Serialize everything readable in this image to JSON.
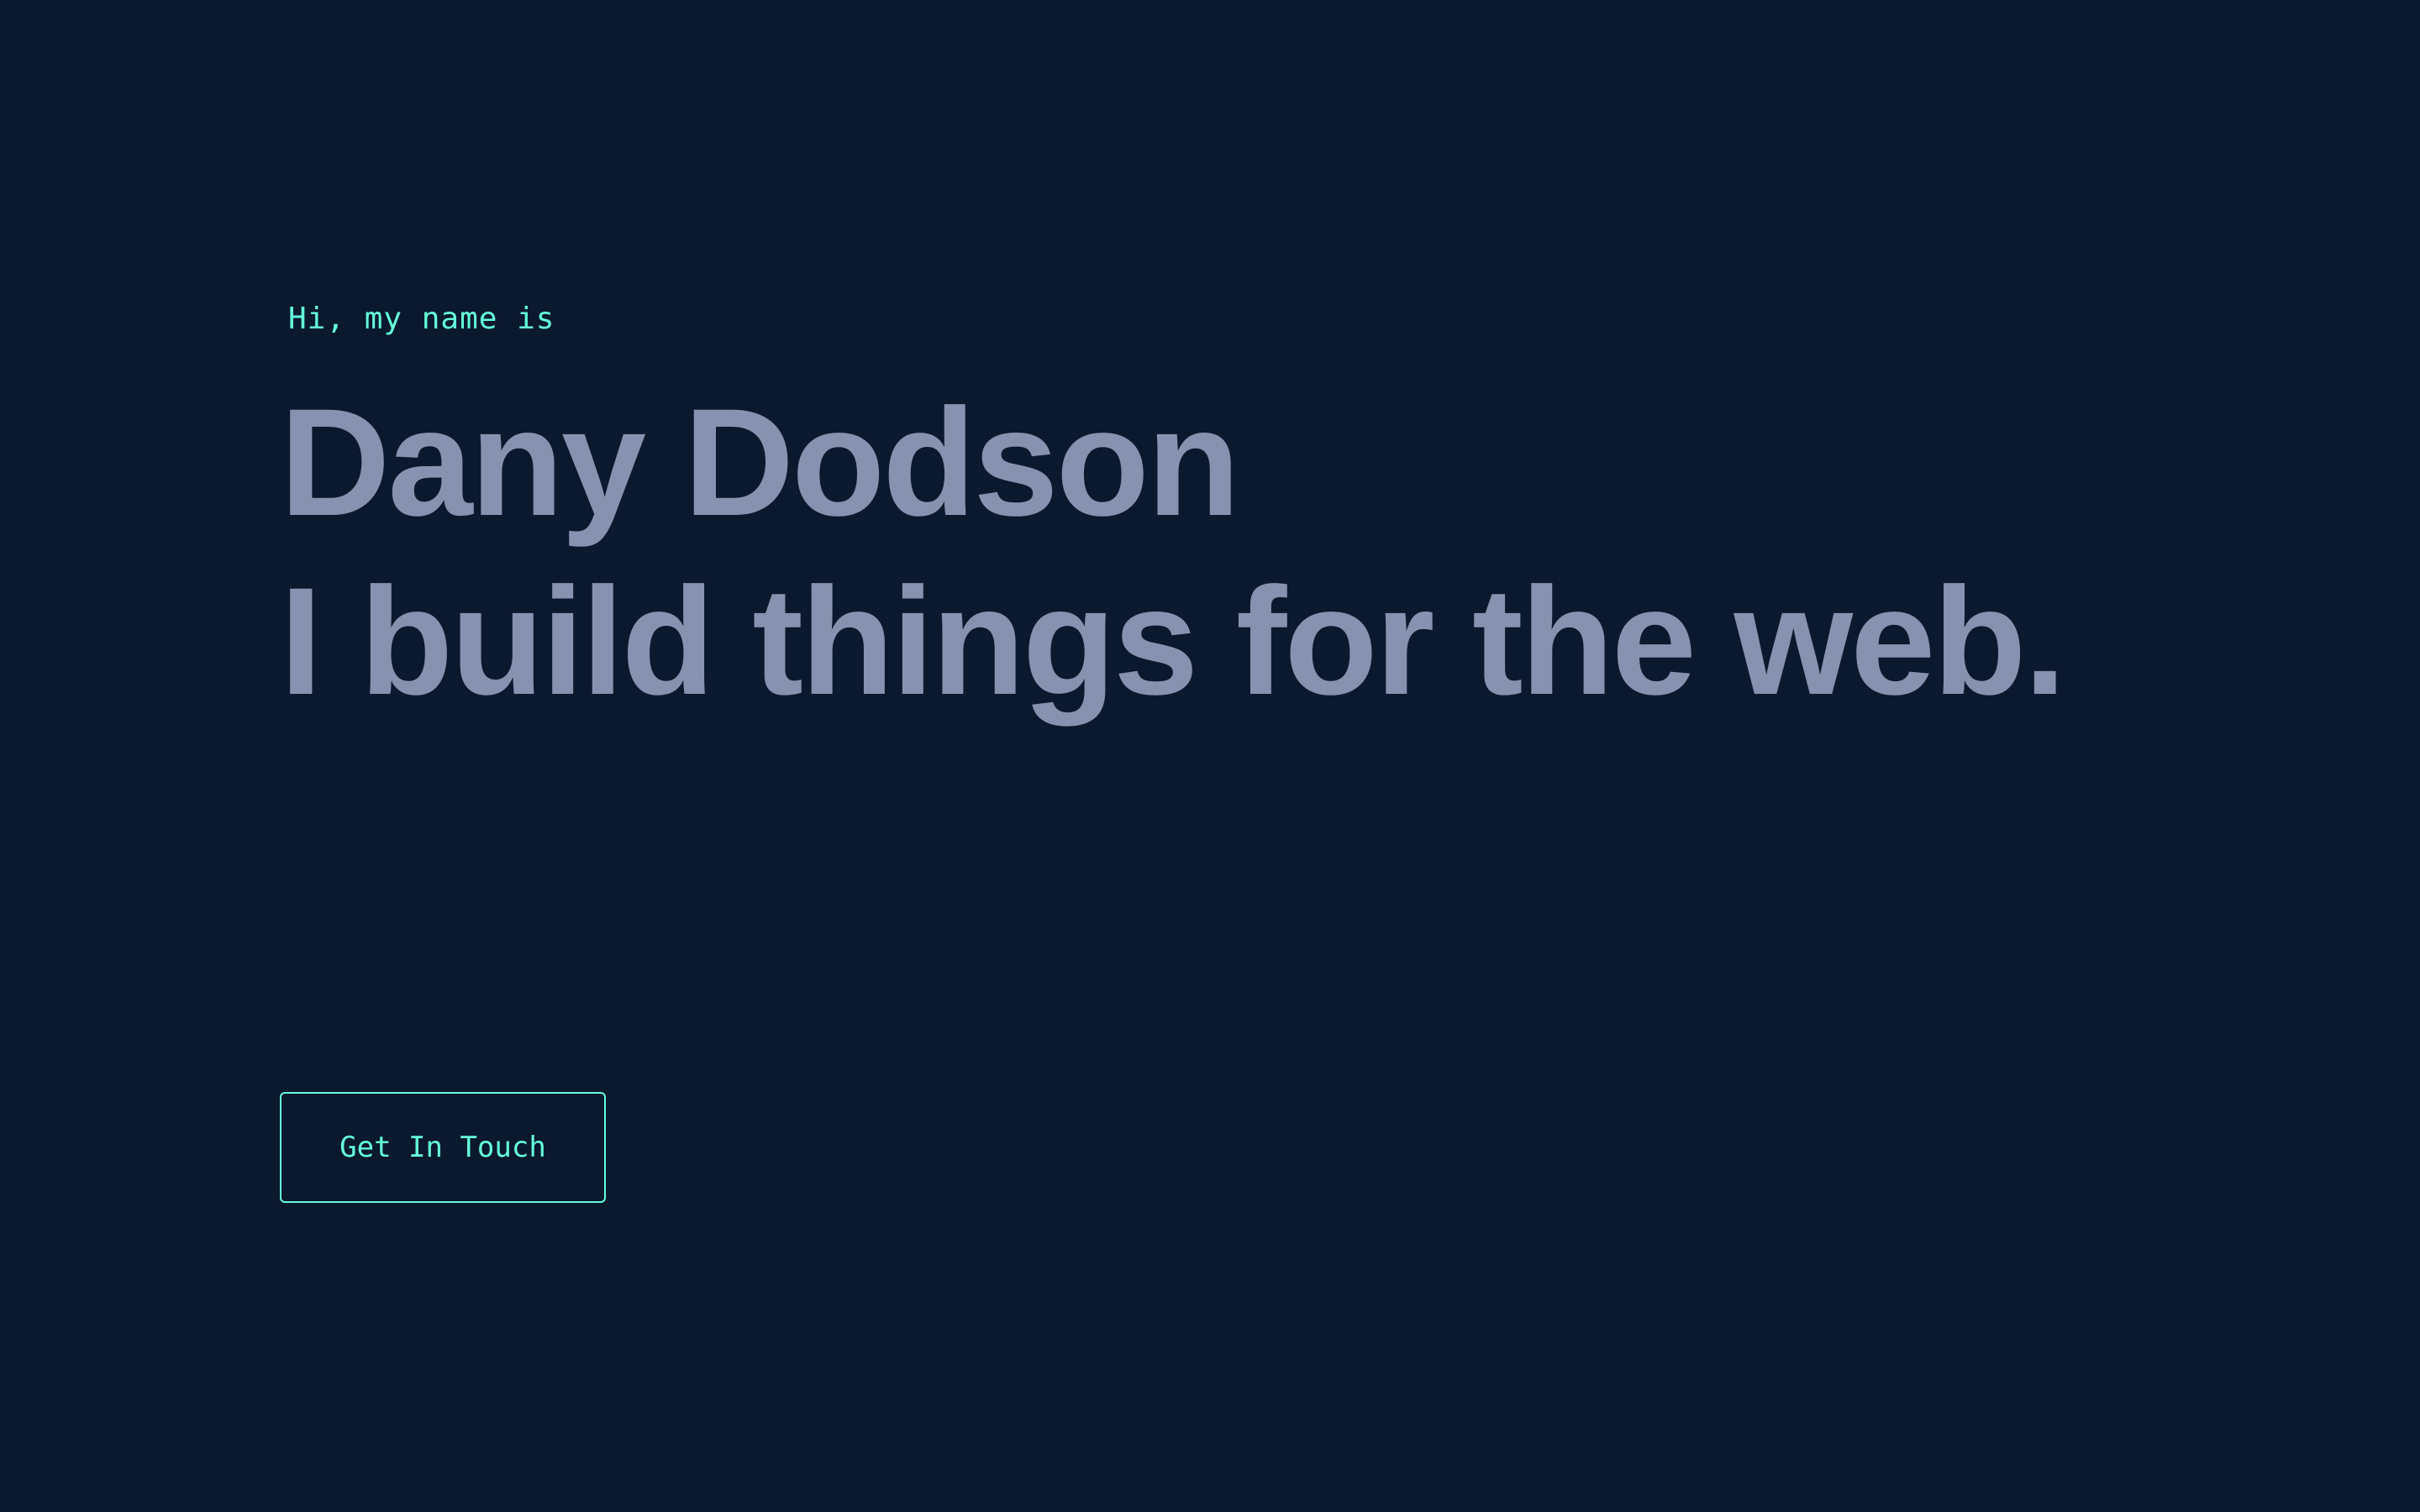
{
  "hero": {
    "greeting": "Hi, my name is",
    "name": "Dany Dodson",
    "tagline": "I build things for the web.",
    "cta_label": "Get In Touch"
  },
  "theme": {
    "background": "#0b192f",
    "accent": "#64ffda",
    "heading_color": "#8892b0"
  }
}
